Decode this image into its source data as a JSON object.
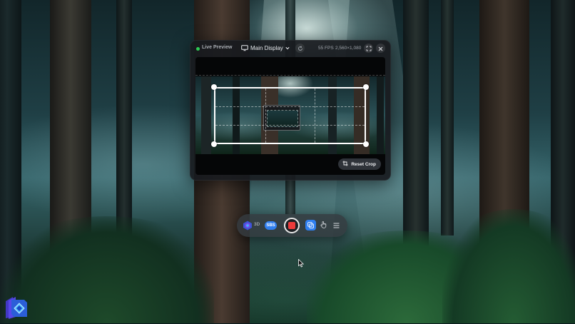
{
  "preview_window": {
    "status_label": "Live Preview",
    "display_selector": "Main Display",
    "fps": "55 FPS",
    "resolution": "2,560×1,080",
    "reset_crop_label": "Reset Crop"
  },
  "toolbar": {
    "mode_3d_label": "3D",
    "mode_sbs_label": "SBS",
    "record_state": "stopped"
  },
  "colors": {
    "live_indicator": "#2ecc55",
    "accent": "#2f7ff0",
    "record": "#ec3b3b"
  },
  "icons": {
    "display": "monitor-icon",
    "display_dropdown": "chevron-down-icon",
    "refresh": "refresh-icon",
    "expand": "expand-icon",
    "close": "close-icon",
    "reset": "crop-reset-icon",
    "logo": "app-logo-icon",
    "record": "record-icon",
    "capture": "capture-window-icon",
    "pointer": "hand-pointer-icon",
    "menu": "menu-icon",
    "cursor": "mouse-cursor-icon"
  }
}
